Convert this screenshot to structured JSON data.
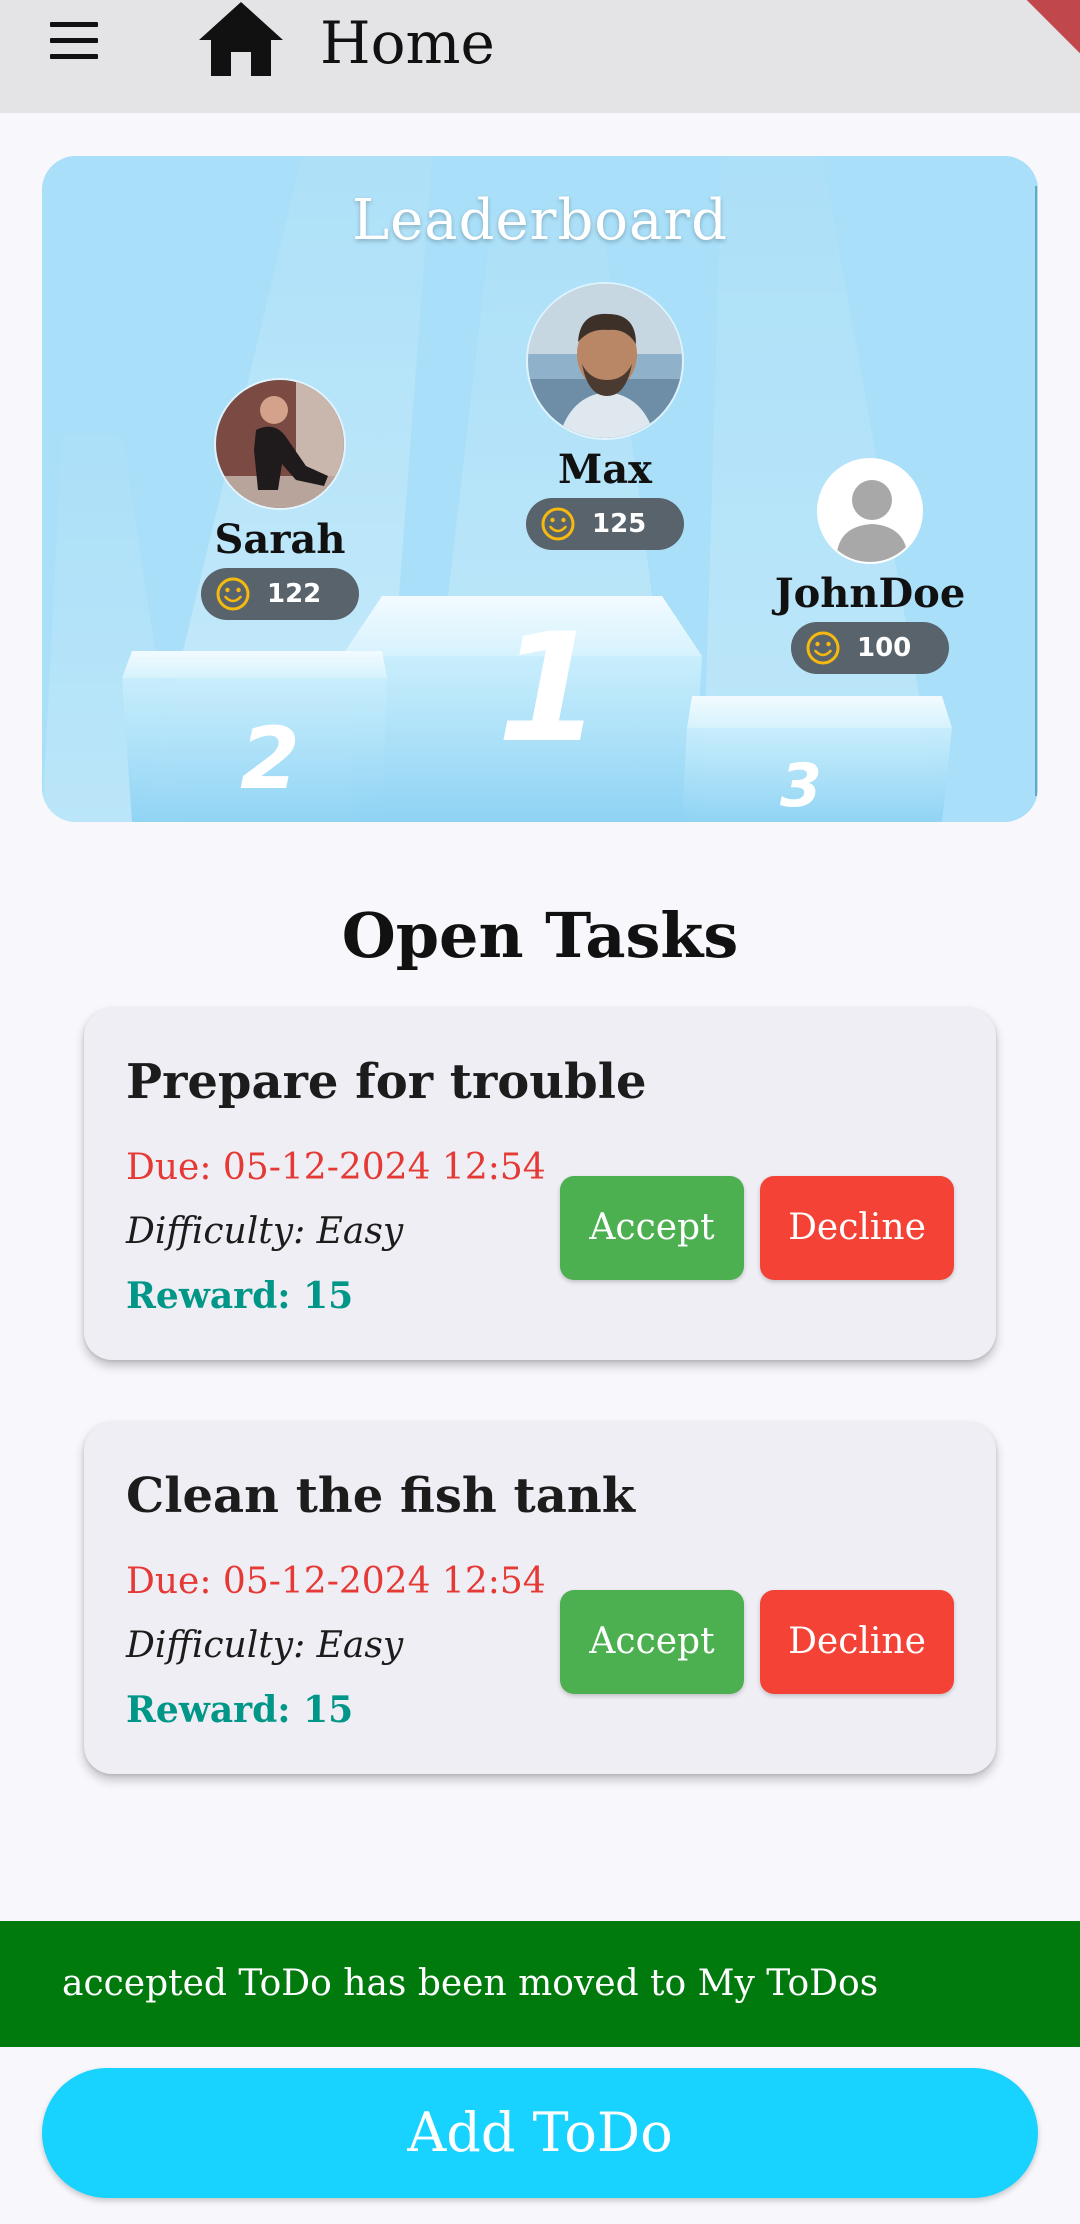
{
  "appbar": {
    "title": "Home",
    "menu_icon": "hamburger-menu-icon",
    "home_icon": "home-icon"
  },
  "leaderboard": {
    "title": "Leaderboard",
    "podium_numbers": [
      "1",
      "2",
      "3"
    ],
    "players": [
      {
        "rank": 1,
        "name": "Max",
        "score": "125",
        "avatar": "photo-avatar"
      },
      {
        "rank": 2,
        "name": "Sarah",
        "score": "122",
        "avatar": "photo-avatar"
      },
      {
        "rank": 3,
        "name": "JohnDoe",
        "score": "100",
        "avatar": "default-person-avatar"
      }
    ],
    "score_icon": "smiley-icon"
  },
  "open_tasks": {
    "title": "Open Tasks",
    "tasks": [
      {
        "title": "Prepare for trouble",
        "due": "Due: 05-12-2024 12:54",
        "difficulty": "Difficulty: Easy",
        "reward": "Reward: 15",
        "accept_label": "Accept",
        "decline_label": "Decline"
      },
      {
        "title": "Clean the fish tank",
        "due": "Due: 05-12-2024 12:54",
        "difficulty": "Difficulty: Easy",
        "reward": "Reward: 15",
        "accept_label": "Accept",
        "decline_label": "Decline"
      }
    ]
  },
  "snackbar": {
    "message": "accepted ToDo has been moved to My ToDos"
  },
  "add_button": {
    "label": "Add ToDo"
  },
  "colors": {
    "appbar": "#E4E3E5",
    "leaderboard_bg": "#A9DFF8",
    "accept": "#4CAF50",
    "decline": "#F44336",
    "due": "#E53935",
    "reward": "#009688",
    "snackbar": "#007A0C",
    "add_button": "#18D2FF"
  }
}
